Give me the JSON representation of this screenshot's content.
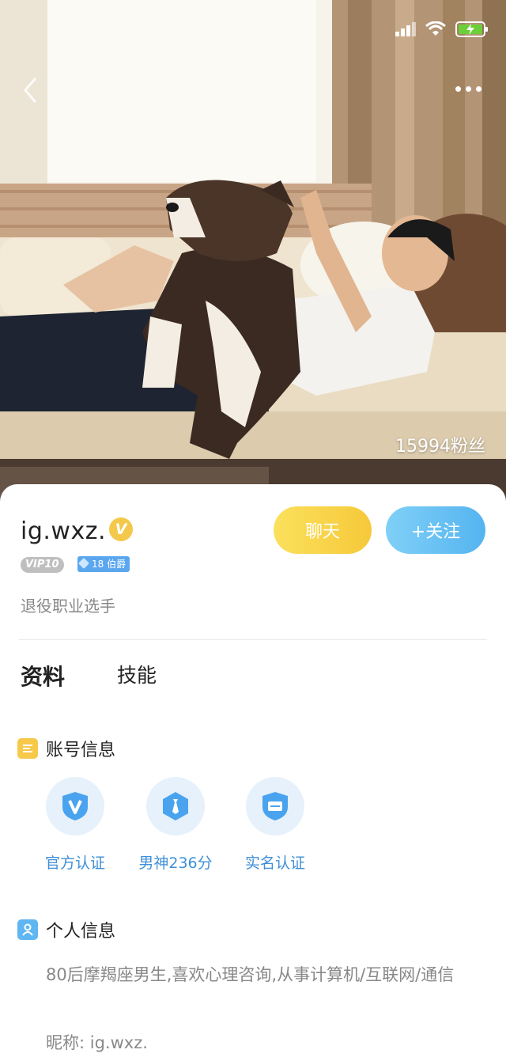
{
  "status_bar": {
    "signal_icon": "signal-icon",
    "wifi_icon": "wifi-icon",
    "battery_icon": "battery-charging-icon"
  },
  "hero": {
    "fans_text": "15994粉丝"
  },
  "profile": {
    "username": "ig.wxz.",
    "verified_badge": "V",
    "vip_label": "VIP10",
    "rank_label": "18 伯爵",
    "bio": "退役职业选手"
  },
  "actions": {
    "chat_label": "聊天",
    "follow_label": "+关注"
  },
  "tabs": [
    {
      "label": "资料",
      "active": true
    },
    {
      "label": "技能",
      "active": false
    }
  ],
  "account_section": {
    "title": "账号信息",
    "items": [
      {
        "label": "官方认证",
        "icon": "shield-v-icon"
      },
      {
        "label": "男神236分",
        "icon": "tie-badge-icon"
      },
      {
        "label": "实名认证",
        "icon": "id-card-icon"
      }
    ]
  },
  "personal_section": {
    "title": "个人信息",
    "description": "80后摩羯座男生,喜欢心理咨询,从事计算机/互联网/通信",
    "nickname_line": "昵称:  ig.wxz."
  },
  "colors": {
    "accent_blue": "#55b4f0",
    "accent_yellow": "#f6c93a",
    "link_blue": "#3f8fd8"
  }
}
